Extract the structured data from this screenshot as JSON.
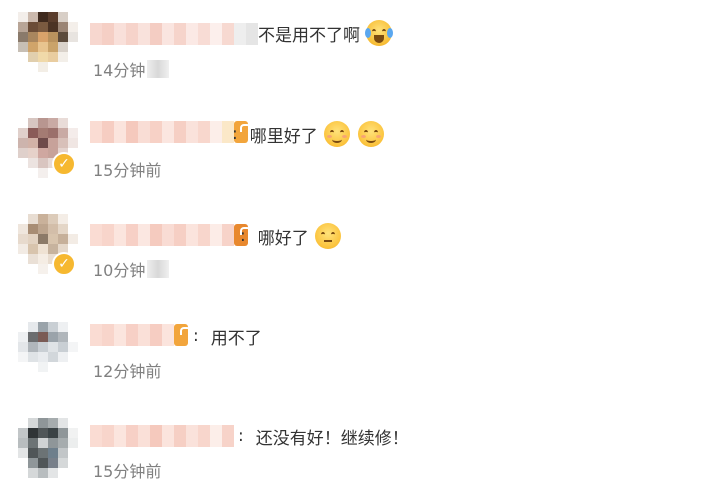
{
  "comments": [
    {
      "message_tail": "不是用不了啊",
      "emoji": [
        "crying-laughing-emoji-icon"
      ],
      "time": "14分钟",
      "colors": [
        "#7a5a40",
        "#3f2a1e",
        "#d9a36b",
        "#5b4a3b",
        "#e8c48f",
        "#c7c7c7"
      ]
    },
    {
      "separator": ":",
      "message": "哪里好了",
      "emoji": [
        "smile-emoji-icon",
        "smile-emoji-icon"
      ],
      "time": "15分钟前",
      "colors": [
        "#b89690",
        "#8a5b58",
        "#d2b2a7",
        "#6e4a4a",
        "#e6d1c9",
        "#c7a29a"
      ]
    },
    {
      "separator": ":",
      "message": "哪好了",
      "emoji": [
        "smirk-emoji-icon"
      ],
      "time": "10分钟",
      "colors": [
        "#c9b19a",
        "#a88d74",
        "#e2d2c1",
        "#8c7a68",
        "#d8c4ad",
        "#efe2d3"
      ]
    },
    {
      "separator": ":",
      "message": "用不了",
      "time": "12分钟前",
      "colors": [
        "#9aa3aa",
        "#6b6d6f",
        "#c9cfd4",
        "#7a5b55",
        "#dfe3e6",
        "#b0b6bb"
      ]
    },
    {
      "separator": ":",
      "message": "还没有好！继续修！",
      "time": "15分钟前",
      "colors": [
        "#505658",
        "#2f3436",
        "#8f9699",
        "#3a4245",
        "#b8bdbf",
        "#6c7375"
      ]
    }
  ]
}
